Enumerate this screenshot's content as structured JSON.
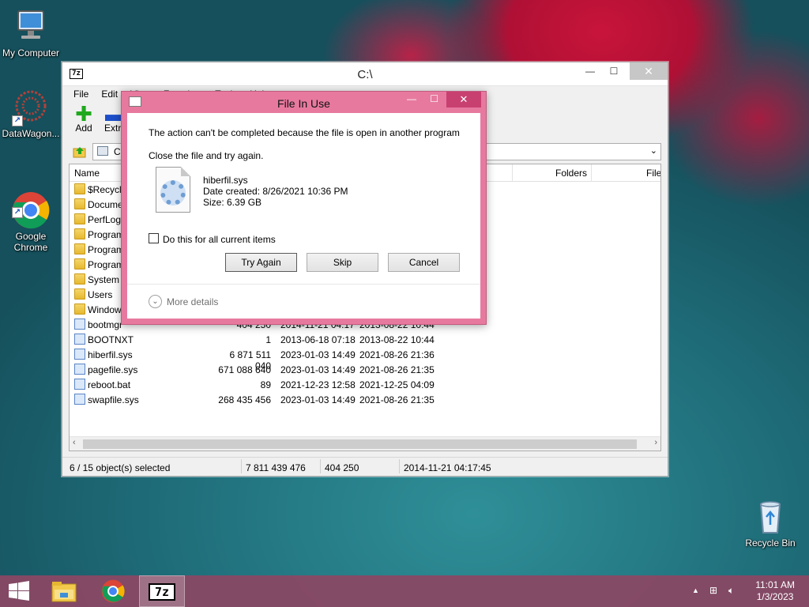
{
  "desktop": {
    "icons": [
      {
        "label": "My Computer"
      },
      {
        "label": "DataWagon..."
      },
      {
        "label": "Google\nChrome"
      },
      {
        "label": "Recycle Bin"
      }
    ]
  },
  "window": {
    "title": "C:\\",
    "app_icon": "7z",
    "menu": [
      "File",
      "Edit",
      "View",
      "Favorites",
      "Tools",
      "Help"
    ],
    "toolbar": {
      "add_label": "Add",
      "extract_label": "Extra"
    },
    "address": "C:\\",
    "columns": {
      "name": "Name",
      "folders": "Folders",
      "files": "File"
    },
    "rows": [
      {
        "name": "$Recycle",
        "type": "folder",
        "size": "",
        "modified": "",
        "created": ""
      },
      {
        "name": "Docume",
        "type": "folder",
        "size": "",
        "modified": "",
        "created": ""
      },
      {
        "name": "PerfLogs",
        "type": "folder",
        "size": "",
        "modified": "",
        "created": ""
      },
      {
        "name": "Program",
        "type": "folder",
        "size": "",
        "modified": "",
        "created": ""
      },
      {
        "name": "Program",
        "type": "folder",
        "size": "",
        "modified": "",
        "created": ""
      },
      {
        "name": "Program",
        "type": "folder",
        "size": "",
        "modified": "",
        "created": ""
      },
      {
        "name": "System V",
        "type": "folder",
        "size": "",
        "modified": "",
        "created": ""
      },
      {
        "name": "Users",
        "type": "folder",
        "size": "",
        "modified": "",
        "created": ""
      },
      {
        "name": "Window",
        "type": "folder",
        "size": "",
        "modified": "",
        "created": ""
      },
      {
        "name": "bootmgr",
        "type": "file",
        "size": "404 250",
        "modified": "2014-11-21 04:17",
        "created": "2013-08-22 10:44"
      },
      {
        "name": "BOOTNXT",
        "type": "file",
        "size": "1",
        "modified": "2013-06-18 07:18",
        "created": "2013-08-22 10:44"
      },
      {
        "name": "hiberfil.sys",
        "type": "file",
        "size": "6 871 511 040",
        "modified": "2023-01-03 14:49",
        "created": "2021-08-26 21:36"
      },
      {
        "name": "pagefile.sys",
        "type": "file",
        "size": "671 088 640",
        "modified": "2023-01-03 14:49",
        "created": "2021-08-26 21:35"
      },
      {
        "name": "reboot.bat",
        "type": "file",
        "size": "89",
        "modified": "2021-12-23 12:58",
        "created": "2021-12-25 04:09"
      },
      {
        "name": "swapfile.sys",
        "type": "file",
        "size": "268 435 456",
        "modified": "2023-01-03 14:49",
        "created": "2021-08-26 21:35"
      }
    ],
    "status": {
      "selected": "6 / 15 object(s) selected",
      "total_size": "7 811 439 476",
      "item_size": "404 250",
      "item_date": "2014-11-21 04:17:45"
    }
  },
  "dialog": {
    "title": "File In Use",
    "message": "The action can't be completed because the file is open in another program",
    "instruction": "Close the file and try again.",
    "file_name": "hiberfil.sys",
    "date_created": "Date created: 8/26/2021 10:36 PM",
    "size": "Size: 6.39 GB",
    "checkbox_label": "Do this for all current items",
    "checkbox_checked": false,
    "buttons": {
      "try_again": "Try Again",
      "skip": "Skip",
      "cancel": "Cancel"
    },
    "more_details": "More details"
  },
  "taskbar": {
    "time": "11:01 AM",
    "date": "1/3/2023",
    "pinned": [
      "start-icon",
      "file-explorer-icon",
      "chrome-icon",
      "7zip-icon"
    ]
  },
  "colors": {
    "dialog_frame": "#e7799f",
    "taskbar": "#8c4664",
    "desktop_bg": "#1d6b77"
  }
}
